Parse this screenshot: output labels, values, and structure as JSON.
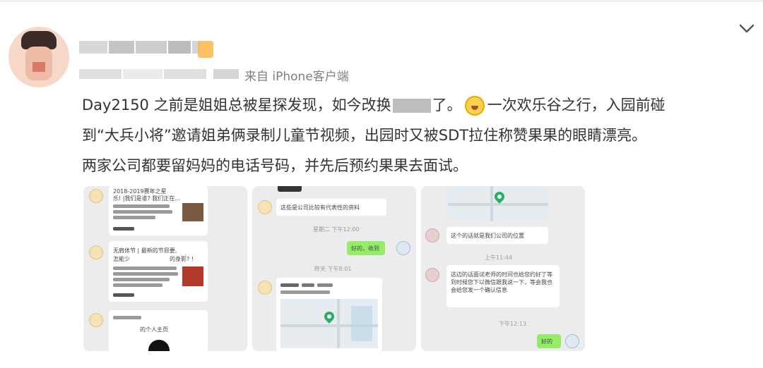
{
  "post": {
    "source_text": "来自 iPhone客户端",
    "lines": [
      {
        "a": "Day2150 之前是姐姐总被星探发现，如今改换",
        "b": "了。",
        "c": "一次欢乐谷之行，入园前碰"
      },
      {
        "a": "到“大兵小将”邀请姐弟俩录制儿童节视频，出园时又被SDT拉住称赞果果的眼睛漂亮。"
      },
      {
        "a": "两家公司都要留妈妈的电话号码，并先后预约果果去面试。"
      }
    ],
    "emoji_icon": "crying-laughing-emoji"
  },
  "images": [
    {
      "name": "screenshot-1",
      "texts": [
        "2018-2019赛年之星",
        "乐! |我们是谁? 我们正在...",
        "无肩体节 | 最新的节目要,",
        "怎能少",
        "的身影? !",
        "的个人主页"
      ]
    },
    {
      "name": "screenshot-2",
      "texts": [
        "这些是公司比较有代表性的资料",
        "星期二 下午12:00",
        "好的，收到",
        "昨天 下午8:01"
      ]
    },
    {
      "name": "screenshot-3",
      "texts": [
        "这个的话就是我们公司的位置",
        "上午11:44",
        "这边的话面试老师的时间也给您约好了等到时候您",
        "下以微信跟我说一下，等会我也会给您发一个确认信息",
        "下午12:13",
        "好的"
      ]
    }
  ],
  "colors": {
    "text": "#333333",
    "meta": "#808080",
    "thumb_bg": "#ececec",
    "chat_green": "#95ec69"
  }
}
